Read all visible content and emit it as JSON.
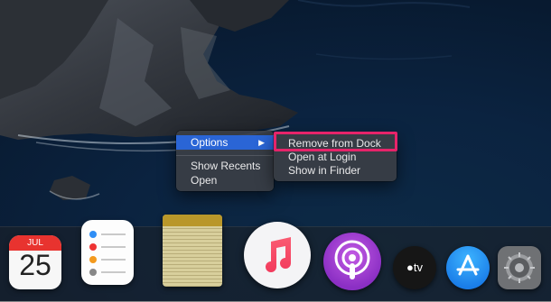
{
  "context_menu": {
    "items": [
      {
        "label": "Options",
        "has_submenu": true,
        "selected": true
      },
      {
        "label": "Show Recents",
        "has_submenu": false,
        "selected": false
      },
      {
        "label": "Open",
        "has_submenu": false,
        "selected": false
      }
    ],
    "submenu_arrow": "▶"
  },
  "options_submenu": {
    "items": [
      {
        "label": "Remove from Dock",
        "highlighted": true
      },
      {
        "label": "Open at Login",
        "highlighted": false
      },
      {
        "label": "Show in Finder",
        "highlighted": false
      }
    ]
  },
  "dock": {
    "apps": [
      {
        "name": "Calendar",
        "icon": "calendar-icon"
      },
      {
        "name": "Reminders",
        "icon": "reminders-icon"
      },
      {
        "name": "Notes",
        "icon": "notes-icon"
      },
      {
        "name": "Music",
        "icon": "music-icon"
      },
      {
        "name": "Podcasts",
        "icon": "podcasts-icon"
      },
      {
        "name": "Apple TV",
        "icon": "apple-tv-icon"
      },
      {
        "name": "App Store",
        "icon": "app-store-icon"
      },
      {
        "name": "System Preferences",
        "icon": "gear-icon"
      }
    ],
    "calendar": {
      "month": "JUL",
      "day": "25"
    },
    "appletv_text": "tv"
  },
  "colors": {
    "menu_selection": "#2a65d6",
    "annotation_highlight": "#e6246a",
    "wallpaper_sea": "#0b2340"
  }
}
